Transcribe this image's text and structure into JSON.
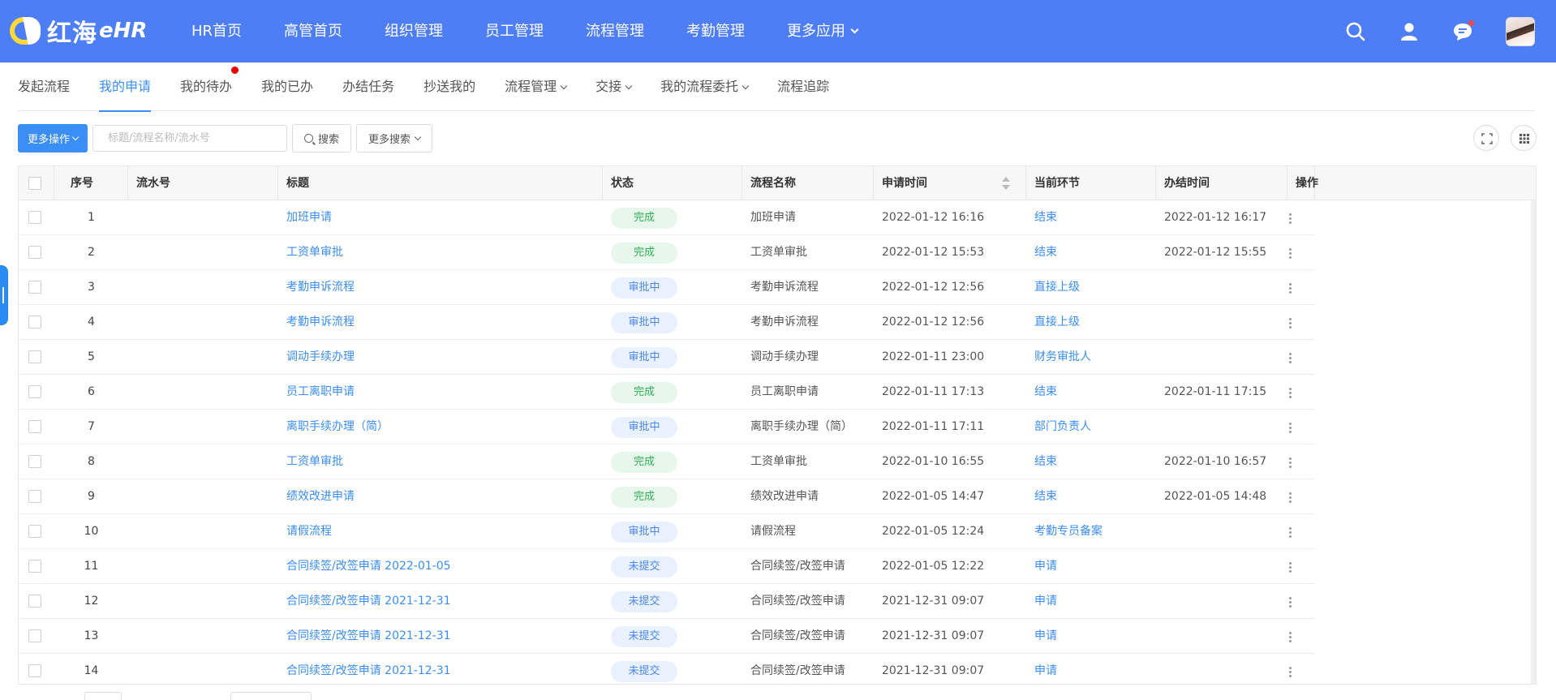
{
  "brand": {
    "name": "红海",
    "suffix": "eHR"
  },
  "nav": [
    {
      "label": "HR首页"
    },
    {
      "label": "高管首页"
    },
    {
      "label": "组织管理"
    },
    {
      "label": "员工管理"
    },
    {
      "label": "流程管理"
    },
    {
      "label": "考勤管理"
    },
    {
      "label": "更多应用"
    }
  ],
  "top_icons": [
    "search-icon",
    "user-icon",
    "message-icon",
    "avatar"
  ],
  "subtabs": [
    {
      "label": "发起流程"
    },
    {
      "label": "我的申请",
      "active": true
    },
    {
      "label": "我的待办",
      "dot": true
    },
    {
      "label": "我的已办"
    },
    {
      "label": "办结任务"
    },
    {
      "label": "抄送我的"
    },
    {
      "label": "流程管理",
      "dropdown": true
    },
    {
      "label": "交接",
      "dropdown": true
    },
    {
      "label": "我的流程委托",
      "dropdown": true
    },
    {
      "label": "流程追踪"
    }
  ],
  "toolbar": {
    "more_ops": "更多操作",
    "search_placeholder": "标题/流程名称/流水号",
    "search_btn": "搜索",
    "more_search": "更多搜索"
  },
  "columns": [
    "序号",
    "流水号",
    "标题",
    "状态",
    "流程名称",
    "申请时间",
    "当前环节",
    "办结时间",
    "操作"
  ],
  "rows": [
    {
      "no": "1",
      "serial": "",
      "title": "加班申请",
      "status": "完成",
      "status_type": "done",
      "flow": "加班申请",
      "apply_time": "2022-01-12 16:16",
      "node": "结束",
      "end_time": "2022-01-12 16:17"
    },
    {
      "no": "2",
      "serial": "",
      "title": "工资单审批",
      "status": "完成",
      "status_type": "done",
      "flow": "工资单审批",
      "apply_time": "2022-01-12 15:53",
      "node": "结束",
      "end_time": "2022-01-12 15:55"
    },
    {
      "no": "3",
      "serial": "",
      "title": "考勤申诉流程",
      "status": "审批中",
      "status_type": "wip",
      "flow": "考勤申诉流程",
      "apply_time": "2022-01-12 12:56",
      "node": "直接上级",
      "end_time": ""
    },
    {
      "no": "4",
      "serial": "",
      "title": "考勤申诉流程",
      "status": "审批中",
      "status_type": "wip",
      "flow": "考勤申诉流程",
      "apply_time": "2022-01-12 12:56",
      "node": "直接上级",
      "end_time": ""
    },
    {
      "no": "5",
      "serial": "",
      "title": "调动手续办理",
      "status": "审批中",
      "status_type": "wip",
      "flow": "调动手续办理",
      "apply_time": "2022-01-11 23:00",
      "node": "财务审批人",
      "end_time": ""
    },
    {
      "no": "6",
      "serial": "",
      "title": "员工离职申请",
      "status": "完成",
      "status_type": "done",
      "flow": "员工离职申请",
      "apply_time": "2022-01-11 17:13",
      "node": "结束",
      "end_time": "2022-01-11 17:15"
    },
    {
      "no": "7",
      "serial": "",
      "title": "离职手续办理（简）",
      "status": "审批中",
      "status_type": "wip",
      "flow": "离职手续办理（简）",
      "apply_time": "2022-01-11 17:11",
      "node": "部门负责人",
      "end_time": ""
    },
    {
      "no": "8",
      "serial": "",
      "title": "工资单审批",
      "status": "完成",
      "status_type": "done",
      "flow": "工资单审批",
      "apply_time": "2022-01-10 16:55",
      "node": "结束",
      "end_time": "2022-01-10 16:57"
    },
    {
      "no": "9",
      "serial": "",
      "title": "绩效改进申请",
      "status": "完成",
      "status_type": "done",
      "flow": "绩效改进申请",
      "apply_time": "2022-01-05 14:47",
      "node": "结束",
      "end_time": "2022-01-05 14:48"
    },
    {
      "no": "10",
      "serial": "",
      "title": "请假流程",
      "status": "审批中",
      "status_type": "wip",
      "flow": "请假流程",
      "apply_time": "2022-01-05 12:24",
      "node": "考勤专员备案",
      "end_time": ""
    },
    {
      "no": "11",
      "serial": "",
      "title": "合同续签/改签申请 2022-01-05",
      "status": "未提交",
      "status_type": "draft",
      "flow": "合同续签/改签申请",
      "apply_time": "2022-01-05 12:22",
      "node": "申请",
      "end_time": ""
    },
    {
      "no": "12",
      "serial": "",
      "title": "合同续签/改签申请 2021-12-31",
      "status": "未提交",
      "status_type": "draft",
      "flow": "合同续签/改签申请",
      "apply_time": "2021-12-31 09:07",
      "node": "申请",
      "end_time": ""
    },
    {
      "no": "13",
      "serial": "",
      "title": "合同续签/改签申请 2021-12-31",
      "status": "未提交",
      "status_type": "draft",
      "flow": "合同续签/改签申请",
      "apply_time": "2021-12-31 09:07",
      "node": "申请",
      "end_time": ""
    },
    {
      "no": "14",
      "serial": "",
      "title": "合同续签/改签申请 2021-12-31",
      "status": "未提交",
      "status_type": "draft",
      "flow": "合同续签/改签申请",
      "apply_time": "2021-12-31 09:07",
      "node": "申请",
      "end_time": ""
    }
  ]
}
